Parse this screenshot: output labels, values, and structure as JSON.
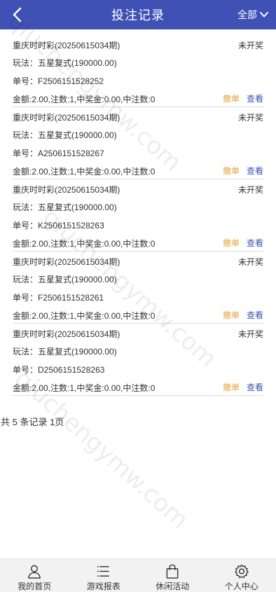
{
  "header": {
    "title": "投注记录",
    "filter_label": "全部"
  },
  "records": [
    {
      "lottery": "重庆时时彩(20250615034期)",
      "status": "未开奖",
      "play": "玩法：五星复式(190000.00)",
      "order": "单号：F2506151528252",
      "amounts": "金额:2.00,注数:1,中奖金:0.00,中注数:0",
      "cancel": "撤单",
      "view": "查看"
    },
    {
      "lottery": "重庆时时彩(20250615034期)",
      "status": "未开奖",
      "play": "玩法：五星复式(190000.00)",
      "order": "单号：A2506151528267",
      "amounts": "金额:2.00,注数:1,中奖金:0.00,中注数:0",
      "cancel": "撤单",
      "view": "查看"
    },
    {
      "lottery": "重庆时时彩(20250615034期)",
      "status": "未开奖",
      "play": "玩法：五星复式(190000.00)",
      "order": "单号：K2506151528263",
      "amounts": "金额:2.00,注数:1,中奖金:0.00,中注数:0",
      "cancel": "撤单",
      "view": "查看"
    },
    {
      "lottery": "重庆时时彩(20250615034期)",
      "status": "未开奖",
      "play": "玩法：五星复式(190000.00)",
      "order": "单号：F2506151528261",
      "amounts": "金额:2.00,注数:1,中奖金:0.00,中注数:0",
      "cancel": "撤单",
      "view": "查看"
    },
    {
      "lottery": "重庆时时彩(20250615034期)",
      "status": "未开奖",
      "play": "玩法：五星复式(190000.00)",
      "order": "单号：D2506151528263",
      "amounts": "金额:2.00,注数:1,中奖金:0.00,中注数:0",
      "cancel": "撤单",
      "view": "查看"
    }
  ],
  "summary": "共 5 条记录 1页",
  "tabbar": [
    {
      "label": "我的首页",
      "icon": "user-icon"
    },
    {
      "label": "游戏报表",
      "icon": "list-icon"
    },
    {
      "label": "休闲活动",
      "icon": "bag-icon"
    },
    {
      "label": "个人中心",
      "icon": "gear-icon"
    }
  ],
  "watermark": {
    "top": "qiuchengymw.com",
    "middle": "qiuchengymw.com",
    "bottom": "qiuchengymw.com"
  },
  "colors": {
    "header_bg": "#3f51b5",
    "cancel": "#e6a23c",
    "view": "#3f51b5"
  }
}
